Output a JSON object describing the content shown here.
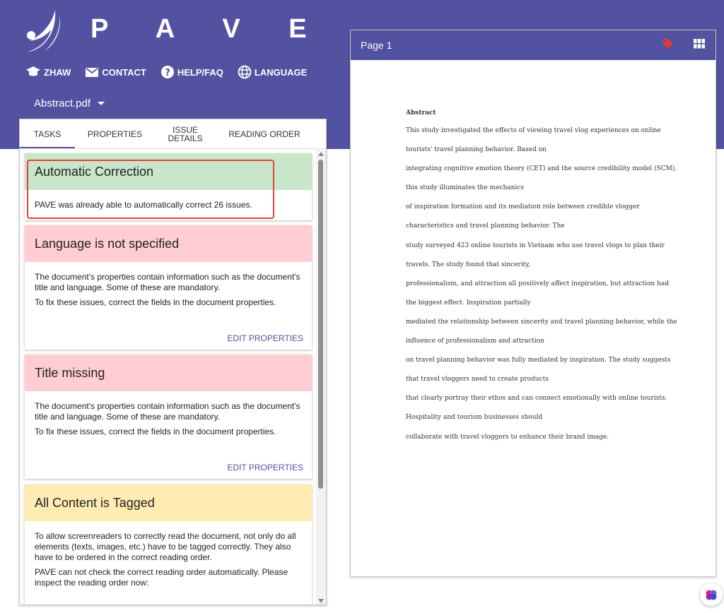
{
  "app": {
    "brand": "P A V E"
  },
  "nav": {
    "items": [
      {
        "label": "ZHAW",
        "icon": "graduation-cap-icon"
      },
      {
        "label": "CONTACT",
        "icon": "mail-icon"
      },
      {
        "label": "HELP/FAQ",
        "icon": "help-circle-icon"
      },
      {
        "label": "LANGUAGE",
        "icon": "globe-icon"
      }
    ]
  },
  "file": {
    "name": "Abstract.pdf"
  },
  "tabs": [
    {
      "label": "TASKS",
      "active": true
    },
    {
      "label": "PROPERTIES"
    },
    {
      "label": "ISSUE DETAILS"
    },
    {
      "label": "READING ORDER"
    }
  ],
  "cards": {
    "auto": {
      "title": "Automatic Correction",
      "body": "PAVE was already able to automatically correct 26 issues.",
      "color": "#c8e6c9"
    },
    "language": {
      "title": "Language is not specified",
      "body1": "The document's properties contain information such as the document's title and language. Some of these are mandatory.",
      "body2": "To fix these issues, correct the fields in the document properties.",
      "action": "EDIT PROPERTIES",
      "color": "#ffcdd2"
    },
    "title_missing": {
      "title": "Title missing",
      "body1": "The document's properties contain information such as the document's title and language. Some of these are mandatory.",
      "body2": "To fix these issues, correct the fields in the document properties.",
      "action": "EDIT PROPERTIES",
      "color": "#ffcdd2"
    },
    "tagged": {
      "title": "All Content is Tagged",
      "body1": "To allow screenreaders to correctly read the document, not only do all elements (texts, images, etc.) have to be tagged correctly. They also have to be ordered in the correct reading order.",
      "body2": "PAVE can not check the correct reading order automatically. Please inspect the reading order now:",
      "color": "#ffecb3"
    }
  },
  "viewer": {
    "page_label": "Page 1",
    "tag_icon": "tag-icon",
    "grid_icon": "grid-icon",
    "doc_title": "Abstract",
    "lines": [
      "This study investigated the effects of viewing travel vlog experiences on online",
      "tourists' travel planning behavior. Based on",
      "integrating cognitive emotion theory (CET) and the source credibility model (SCM),",
      "this study illuminates the mechanics",
      "of inspiration formation and its mediation role between credible vlogger",
      "characteristics and travel planning behavior. The",
      "study surveyed 423 online tourists in Vietnam who use travel vlogs to plan their",
      "travels. The study found that sincerity,",
      "professionalism, and attraction all positively affect inspiration, but attraction had",
      "the biggest effect. Inspiration partially",
      "mediated the relationship between sincerity and travel planning behavior, while the",
      "influence of professionalism and attraction",
      "on travel planning behavior was fully mediated by inspiration. The study suggests",
      "that travel vloggers need to create products",
      "that clearly portray their ethos and can connect emotionally with online tourists.",
      "Hospitality and tourism businesses should",
      "collaborate with travel vloggers to enhance their brand image."
    ]
  },
  "colors": {
    "primary": "#5252a0",
    "highlight": "#e0413b"
  }
}
